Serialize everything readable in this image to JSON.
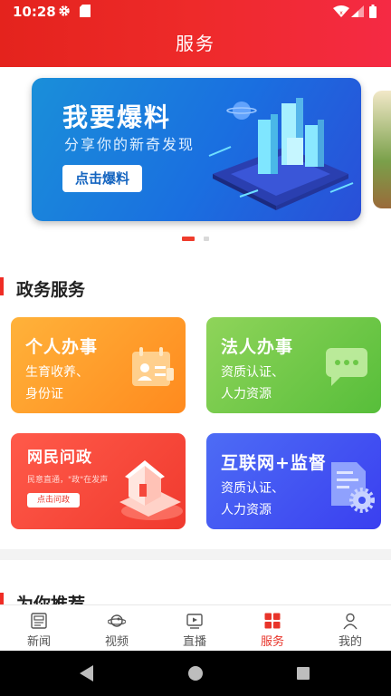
{
  "status_bar": {
    "time": "10:28"
  },
  "header": {
    "title": "服务"
  },
  "banner": {
    "title": "我要爆料",
    "subtitle": "分享你的新奇发现",
    "button_label": "点击爆料",
    "page_count": 2,
    "active_page": 1
  },
  "sections": {
    "government": {
      "title": "政务服务"
    },
    "recommend": {
      "title": "为你推荐"
    }
  },
  "services": [
    {
      "title": "个人办事",
      "line1": "生育收养、",
      "line2": "身份证",
      "icon": "id-card-icon",
      "color": "#ff9a2a"
    },
    {
      "title": "法人办事",
      "line1": "资质认证、",
      "line2": "人力资源",
      "icon": "chat-bubble-icon",
      "color": "#6cc847"
    },
    {
      "title": "网民问政",
      "small_text": "民意直通，\"政\"在发声",
      "button_label": "点击问政",
      "icon": "building-icon",
      "color": "#f5473a"
    },
    {
      "title": "互联网+监督",
      "line1": "资质认证、",
      "line2": "人力资源",
      "icon": "document-gear-icon",
      "color": "#4050f2"
    }
  ],
  "bottom_nav": [
    {
      "label": "新闻",
      "icon": "news-icon",
      "active": false
    },
    {
      "label": "视频",
      "icon": "video-planet-icon",
      "active": false
    },
    {
      "label": "直播",
      "icon": "live-tv-icon",
      "active": false
    },
    {
      "label": "服务",
      "icon": "service-grid-icon",
      "active": true
    },
    {
      "label": "我的",
      "icon": "profile-icon",
      "active": false
    }
  ],
  "colors": {
    "accent": "#e8342a",
    "header_gradient_start": "#e4231d",
    "header_gradient_end": "#f52a44"
  }
}
